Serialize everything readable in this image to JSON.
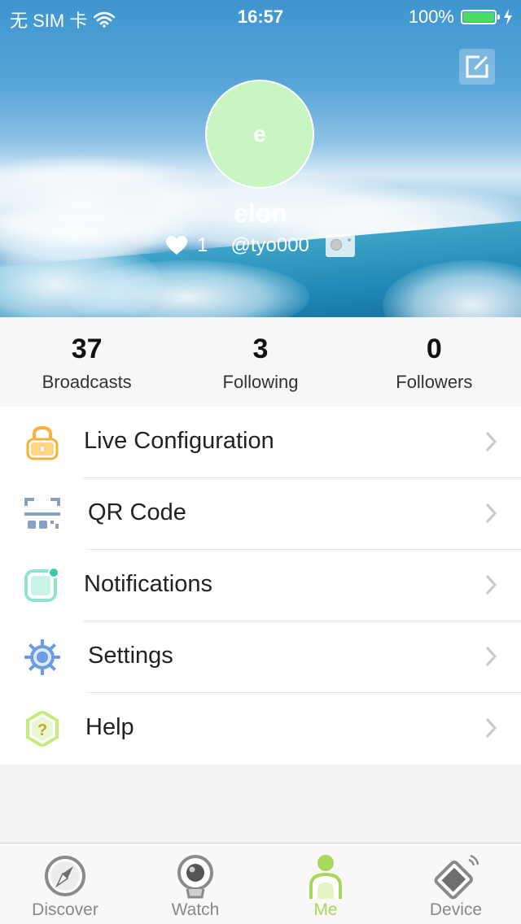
{
  "status_bar": {
    "carrier": "无 SIM 卡",
    "time": "16:57",
    "battery": "100%",
    "battery_level": 1.0
  },
  "profile": {
    "avatar_initial": "e",
    "avatar_color": "#c8f5c2",
    "username": "elon",
    "likes": "1",
    "handle": "@tyo000",
    "edit_icon": "edit-icon",
    "camera_icon": "camera-icon"
  },
  "stats": [
    {
      "value": "37",
      "label": "Broadcasts"
    },
    {
      "value": "3",
      "label": "Following"
    },
    {
      "value": "0",
      "label": "Followers"
    }
  ],
  "menu": [
    {
      "label": "Live Configuration",
      "icon": "lock-icon",
      "color": "#f7b13a"
    },
    {
      "label": "QR Code",
      "icon": "qr-code-icon",
      "color": "#8aa0c2"
    },
    {
      "label": "Notifications",
      "icon": "notification-icon",
      "color": "#7fe0c8"
    },
    {
      "label": "Settings",
      "icon": "gear-icon",
      "color": "#6b9de0"
    },
    {
      "label": "Help",
      "icon": "help-icon",
      "color": "#b6e85a"
    }
  ],
  "tabs": [
    {
      "label": "Discover",
      "icon": "compass-icon",
      "active": false
    },
    {
      "label": "Watch",
      "icon": "webcam-icon",
      "active": false
    },
    {
      "label": "Me",
      "icon": "person-icon",
      "active": true
    },
    {
      "label": "Device",
      "icon": "device-icon",
      "active": false
    }
  ],
  "colors": {
    "accent": "#a8d85a",
    "tab_inactive": "#888888",
    "battery_fill": "#4cd964"
  }
}
